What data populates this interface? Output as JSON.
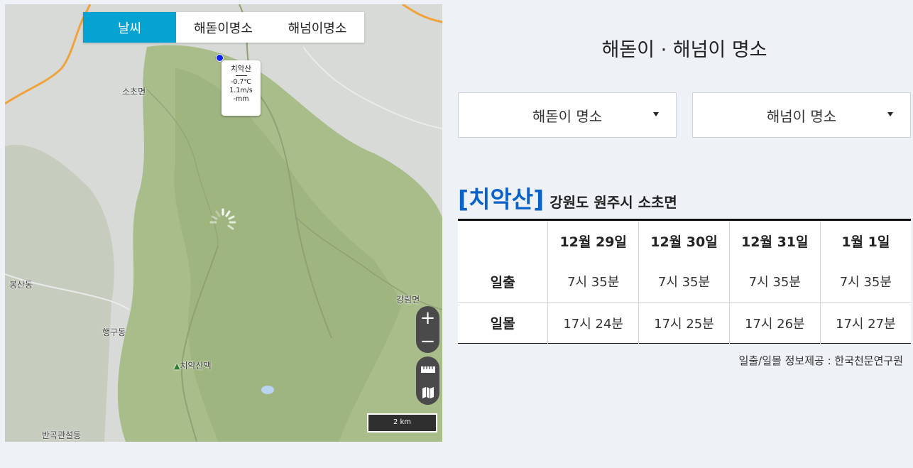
{
  "map": {
    "tabs": [
      "날씨",
      "해돋이명소",
      "해넘이명소"
    ],
    "places": [
      "소초면",
      "봉산동",
      "행구동",
      "강림면",
      "치악산맥",
      "반곡관설동"
    ],
    "popup": {
      "name": "치악산",
      "temperature": "-0.7℃",
      "wind": "1.1m/s",
      "rain": "-mm"
    },
    "scale_label": "2 km",
    "zoom_in": "+",
    "zoom_out": "−"
  },
  "panel": {
    "title": "해돋이 · 해넘이 명소",
    "select_sunrise": "해돋이 명소",
    "select_sunset": "해넘이 명소",
    "location_name": "[치악산]",
    "location_addr": "강원도 원주시 소초면",
    "source": "일출/일몰 정보제공 : 한국천문연구원"
  },
  "table": {
    "dates": [
      "12월 29일",
      "12월 30일",
      "12월 31일",
      "1월 1일"
    ],
    "rows": [
      {
        "label": "일출",
        "values": [
          "7시 35분",
          "7시 35분",
          "7시 35분",
          "7시 35분"
        ]
      },
      {
        "label": "일몰",
        "values": [
          "17시 24분",
          "17시 25분",
          "17시 26분",
          "17시 27분"
        ]
      }
    ]
  },
  "colors": {
    "active_tab": "#05a3d1",
    "location_name": "#0a62c9",
    "marker": "#1024f0",
    "terrain_green": "#a9bd8a",
    "page_background": "#eef1f5"
  }
}
